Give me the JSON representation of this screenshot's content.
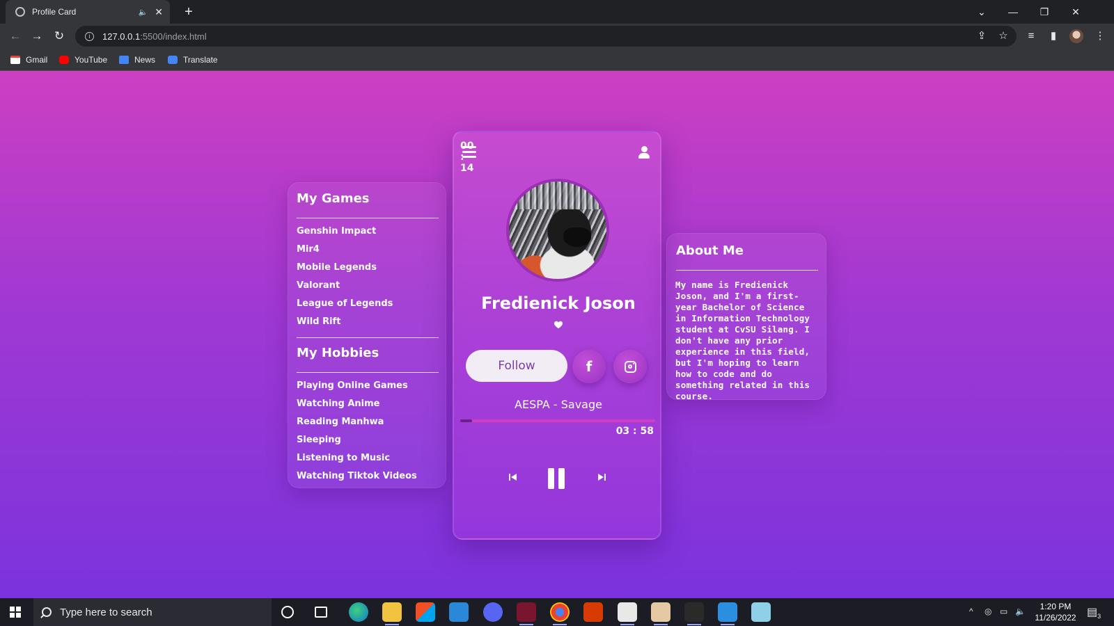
{
  "browser": {
    "tab_title": "Profile Card",
    "url_host": "127.0.0.1",
    "url_path": ":5500/index.html",
    "bookmarks": [
      "Gmail",
      "YouTube",
      "News",
      "Translate"
    ]
  },
  "card": {
    "name": "Fredienick Joson",
    "follow_label": "Follow",
    "song": "AESPA - Savage",
    "time_current": "00 : 14",
    "time_total": "03 : 58",
    "progress_fraction": 0.06
  },
  "games": {
    "heading": "My Games",
    "items": [
      "Genshin Impact",
      "Mir4",
      "Mobile Legends",
      "Valorant",
      "League of Legends",
      "Wild Rift"
    ]
  },
  "hobbies": {
    "heading": "My Hobbies",
    "items": [
      "Playing Online Games",
      "Watching Anime",
      "Reading Manhwa",
      "Sleeping",
      "Listening to Music",
      "Watching Tiktok Videos"
    ]
  },
  "about": {
    "heading": "About Me",
    "text": "My name is Fredienick Joson, and I'm a first-year Bachelor of Science in Information Technology student at CvSU Silang. I don't have any prior experience in this field, but I'm hoping to learn how to code and do something related in this course."
  },
  "taskbar": {
    "search_placeholder": "Type here to search",
    "time": "1:20 PM",
    "date": "11/26/2022",
    "notification_count": "3"
  },
  "colors": {
    "bg_top": "#cc3fc2",
    "bg_bottom": "#7b33dd",
    "accent": "#d23cc0"
  }
}
